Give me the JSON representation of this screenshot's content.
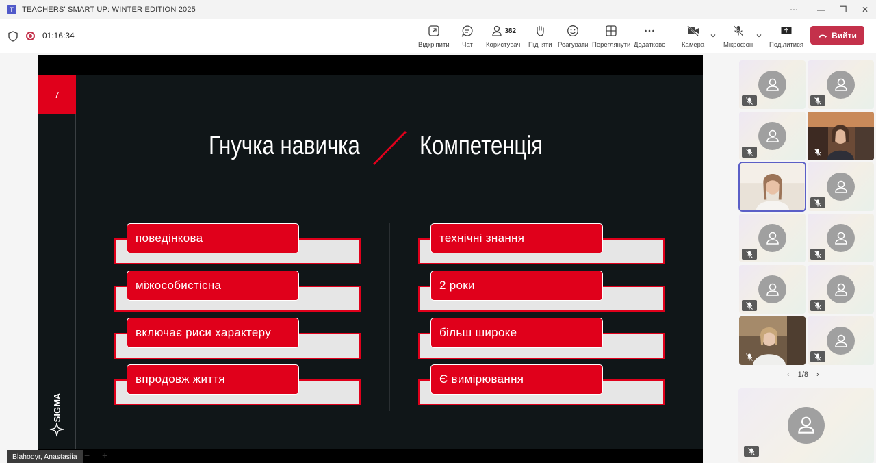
{
  "window": {
    "title": "TEACHERS' SMART UP: WINTER EDITION 2025"
  },
  "meeting": {
    "timer": "01:16:34",
    "participant_count": "382",
    "buttons": {
      "popout": "Відкріпити",
      "chat": "Чат",
      "people": "Користувачі",
      "raise": "Підняти",
      "react": "Реагувати",
      "view": "Переглянути",
      "more": "Додатково",
      "camera": "Камера",
      "mic": "Мікрофон",
      "share": "Поділитися",
      "leave": "Вийти"
    }
  },
  "slide": {
    "page_number": "7",
    "title_left": "Гнучка навичка",
    "title_right": "Компетенція",
    "left_items": [
      "поведінкова",
      "міжособистісна",
      "включає риси характеру",
      "впродовж життя"
    ],
    "right_items": [
      "технічні знання",
      "2 роки",
      "більш широке",
      "Є вимірювання"
    ],
    "logo_text": "SIGMA"
  },
  "stage": {
    "presenter_name": "Blahodyr, Anastasiia"
  },
  "gallery": {
    "page_indicator": "1/8"
  },
  "colors": {
    "leave": "#c4314b",
    "slide_accent": "#e0001b",
    "slide_bg": "#101618",
    "selected_tile": "#5b5fc7"
  }
}
